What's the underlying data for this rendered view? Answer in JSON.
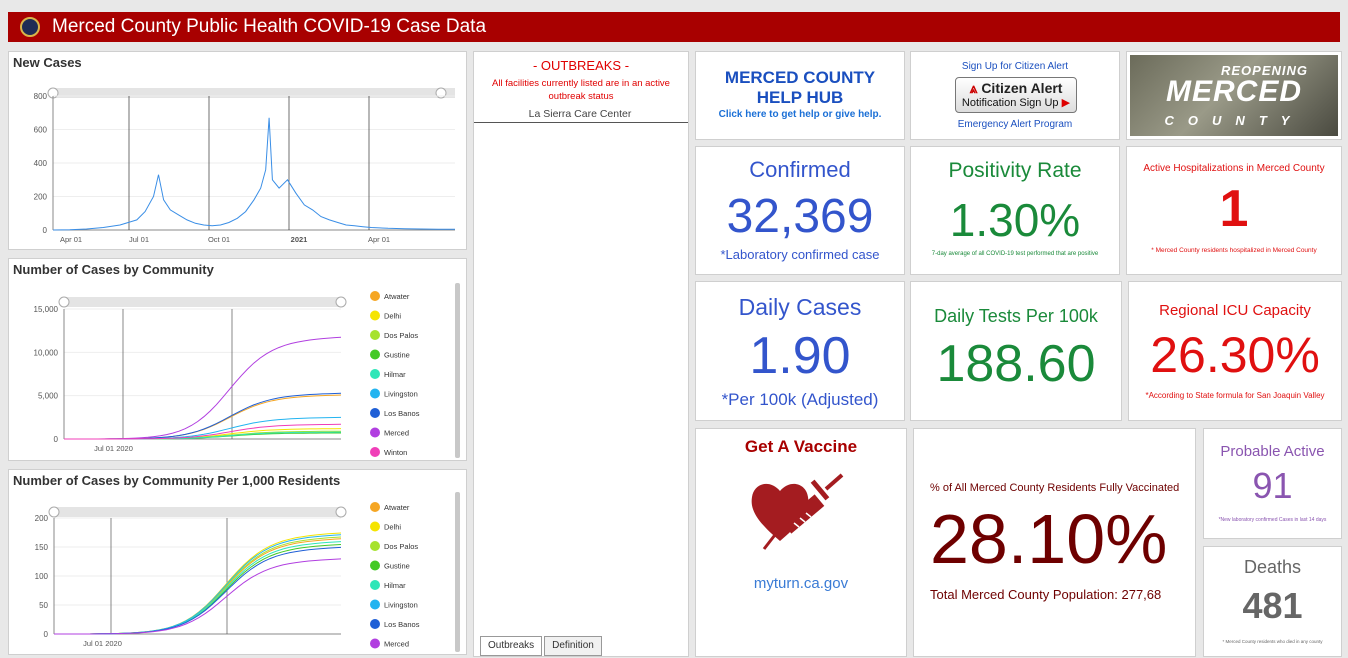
{
  "header": {
    "title": "Merced County Public Health COVID-19 Case Data"
  },
  "new_cases": {
    "title": "New Cases",
    "chart_data": {
      "type": "line",
      "title": "New Cases",
      "y_ticks": [
        "800",
        "600",
        "400",
        "200",
        "0"
      ],
      "x_ticks": [
        "Apr 01",
        "Jul 01",
        "Oct 01",
        "2021",
        "Apr 01"
      ],
      "ylim": [
        0,
        800
      ],
      "description_points": [
        [
          0,
          0
        ],
        [
          10,
          2
        ],
        [
          20,
          6
        ],
        [
          30,
          15
        ],
        [
          40,
          30
        ],
        [
          50,
          60
        ],
        [
          55,
          110
        ],
        [
          60,
          200
        ],
        [
          63,
          330
        ],
        [
          66,
          180
        ],
        [
          70,
          120
        ],
        [
          75,
          90
        ],
        [
          80,
          60
        ],
        [
          85,
          40
        ],
        [
          90,
          30
        ],
        [
          95,
          25
        ],
        [
          100,
          30
        ],
        [
          105,
          45
        ],
        [
          110,
          70
        ],
        [
          115,
          110
        ],
        [
          120,
          180
        ],
        [
          124,
          250
        ],
        [
          127,
          360
        ],
        [
          129,
          670
        ],
        [
          131,
          300
        ],
        [
          135,
          250
        ],
        [
          140,
          300
        ],
        [
          145,
          220
        ],
        [
          150,
          150
        ],
        [
          155,
          120
        ],
        [
          160,
          80
        ],
        [
          165,
          60
        ],
        [
          170,
          45
        ],
        [
          175,
          30
        ],
        [
          180,
          25
        ],
        [
          185,
          20
        ],
        [
          190,
          15
        ],
        [
          200,
          10
        ],
        [
          210,
          8
        ],
        [
          220,
          6
        ],
        [
          230,
          5
        ],
        [
          240,
          4
        ]
      ],
      "color": "#3a8ee6"
    }
  },
  "by_community": {
    "title": "Number of Cases by Community",
    "chart_data": {
      "type": "line",
      "y_ticks": [
        "15,000",
        "10,000",
        "5,000",
        "0"
      ],
      "x_ticks": [
        "Jul 01 2020"
      ],
      "ylim": [
        0,
        15000
      ],
      "series": [
        {
          "name": "Atwater",
          "color": "#f5a623",
          "end": 5100
        },
        {
          "name": "Delhi",
          "color": "#f5e400",
          "end": 1200
        },
        {
          "name": "Dos Palos",
          "color": "#a6e22e",
          "end": 900
        },
        {
          "name": "Gustine",
          "color": "#43c926",
          "end": 700
        },
        {
          "name": "Hilmar",
          "color": "#2ee6b8",
          "end": 800
        },
        {
          "name": "Livingston",
          "color": "#23b4f0",
          "end": 2500
        },
        {
          "name": "Los Banos",
          "color": "#1f5fd6",
          "end": 5300
        },
        {
          "name": "Merced",
          "color": "#b13fe0",
          "end": 11800
        },
        {
          "name": "Winton",
          "color": "#f03fb8",
          "end": 1700
        }
      ]
    }
  },
  "per_1000": {
    "title": "Number of Cases by Community Per 1,000 Residents",
    "chart_data": {
      "type": "line",
      "y_ticks": [
        "200",
        "150",
        "100",
        "50",
        "0"
      ],
      "x_ticks": [
        "Jul 01 2020"
      ],
      "ylim": [
        0,
        200
      ],
      "series": [
        {
          "name": "Atwater",
          "color": "#f5a623",
          "end": 165
        },
        {
          "name": "Delhi",
          "color": "#f5e400",
          "end": 175
        },
        {
          "name": "Dos Palos",
          "color": "#a6e22e",
          "end": 168
        },
        {
          "name": "Gustine",
          "color": "#43c926",
          "end": 155
        },
        {
          "name": "Hilmar",
          "color": "#2ee6b8",
          "end": 160
        },
        {
          "name": "Livingston",
          "color": "#23b4f0",
          "end": 172
        },
        {
          "name": "Los Banos",
          "color": "#1f5fd6",
          "end": 150
        },
        {
          "name": "Merced",
          "color": "#b13fe0",
          "end": 130
        }
      ]
    }
  },
  "outbreaks": {
    "title": "- OUTBREAKS -",
    "subtitle": "All facilities currently listed are in an active outbreak status",
    "items": [
      "La Sierra Care Center"
    ],
    "tabs": [
      "Outbreaks",
      "Definition"
    ]
  },
  "helphub": {
    "line1": "MERCED COUNTY",
    "line2": "HELP HUB",
    "link": "Click here to get help or give help."
  },
  "citizen_alert": {
    "top": "Sign Up for Citizen Alert",
    "brand": "Citizen Alert",
    "button": "Notification Sign Up",
    "bottom": "Emergency Alert Program"
  },
  "reopening": {
    "top": "REOPENING",
    "main": "MERCED",
    "bottom": "COUNTY"
  },
  "confirmed": {
    "title": "Confirmed",
    "value": "32,369",
    "note": "*Laboratory confirmed case"
  },
  "positivity": {
    "title": "Positivity Rate",
    "value": "1.30%",
    "note": "7-day average of all COVID-19 test performed that are positive"
  },
  "hospital": {
    "title": "Active Hospitalizations in Merced County",
    "value": "1",
    "note": "* Merced County residents hospitalized in Merced County"
  },
  "daily_cases": {
    "title": "Daily Cases",
    "value": "1.90",
    "note": "*Per 100k (Adjusted)"
  },
  "daily_tests": {
    "title": "Daily Tests Per 100k",
    "value": "188.60"
  },
  "icu": {
    "title": "Regional ICU Capacity",
    "value": "26.30%",
    "note": "*According to State formula for San Joaquin Valley"
  },
  "vaccine": {
    "title": "Get A Vaccine",
    "link": "myturn.ca.gov"
  },
  "vaccinated": {
    "title": "% of All Merced County Residents Fully Vaccinated",
    "value": "28.10%",
    "note": "Total Merced County Population: 277,68"
  },
  "probable": {
    "title": "Probable Active",
    "value": "91",
    "note": "*New laboratory confirmed Cases in last 14 days"
  },
  "deaths": {
    "title": "Deaths",
    "value": "481",
    "note": "* Merced County residents who died in any county"
  },
  "colors": {
    "brand": "#a80000",
    "blue": "#3355cc",
    "green": "#1a8a3a",
    "red": "#e01010",
    "maroon": "#6e0000",
    "purple": "#8a55b0",
    "gray": "#666666"
  }
}
